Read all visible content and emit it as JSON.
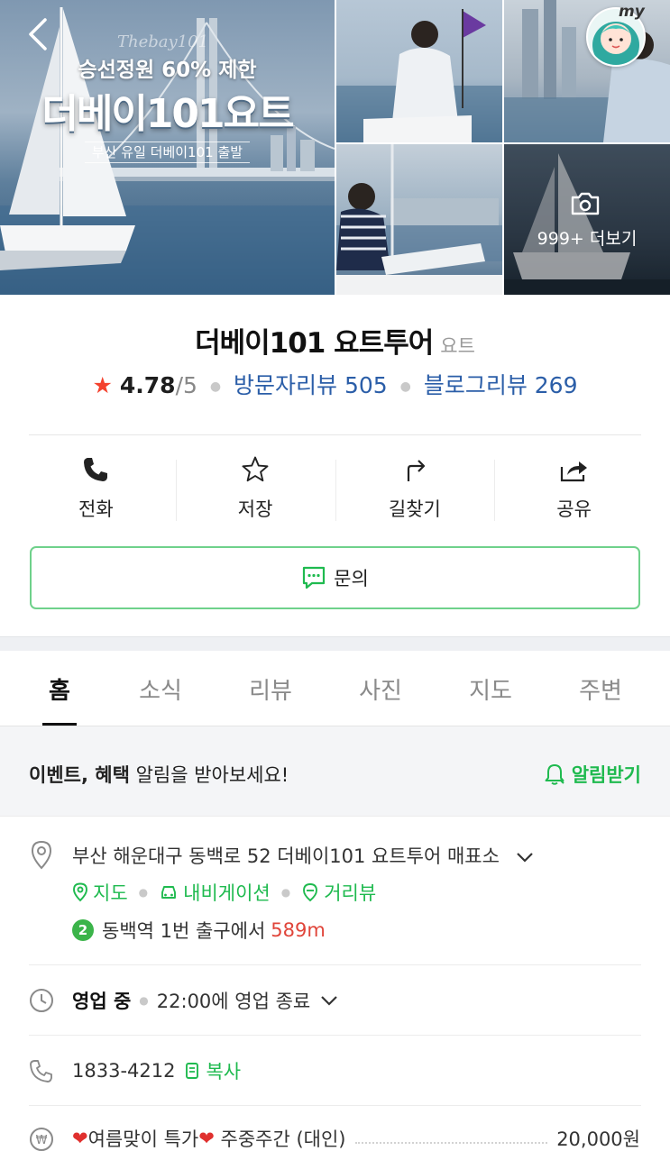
{
  "gallery": {
    "hero_sub": "승선정원 60% 제한",
    "hero_title": "더베이101요트",
    "hero_script": "Thebay101",
    "hero_tag": "부산 유일 더베이101 출발",
    "more_label": "999+ 더보기",
    "my_label": "my"
  },
  "place": {
    "name": "더베이101 요트투어",
    "category": "요트",
    "rating": "4.78",
    "rating_max": "/5",
    "visitor_reviews": "방문자리뷰 505",
    "blog_reviews": "블로그리뷰 269"
  },
  "actions": {
    "call": "전화",
    "save": "저장",
    "directions": "길찾기",
    "share": "공유",
    "inquiry": "문의"
  },
  "tabs": [
    "홈",
    "소식",
    "리뷰",
    "사진",
    "지도",
    "주변"
  ],
  "notice": {
    "bold": "이벤트, 혜택",
    "text": " 알림을 받아보세요!",
    "action": "알림받기"
  },
  "info": {
    "address": "부산 해운대구 동백로 52 더베이101 요트투어 매표소",
    "link_map": "지도",
    "link_navi": "내비게이션",
    "link_street": "거리뷰",
    "subway_line": "2",
    "subway_station": "동백역",
    "subway_exit": "1번 출구에서",
    "subway_distance": "589m",
    "status": "영업 중",
    "hours": "22:00에 영업 종료",
    "phone": "1833-4212",
    "copy": "복사",
    "price_heart": "❤",
    "price_label": "여름맞이 특가",
    "price_detail": "주중주간 (대인)",
    "price_amount": "20,000원"
  },
  "colors": {
    "accent_green": "#1fba4f",
    "link_blue": "#2b5ea8",
    "star_red": "#f4422e",
    "distance_red": "#e0453a"
  }
}
